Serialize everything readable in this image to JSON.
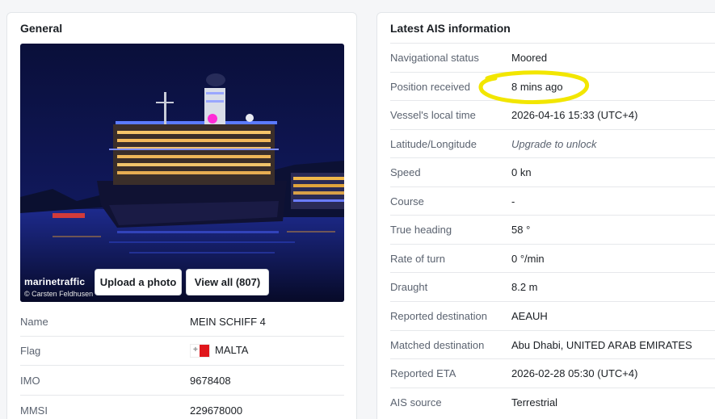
{
  "general": {
    "title": "General",
    "photo": {
      "brand": "marinetraffic",
      "credit": "© Carsten Feldhusen",
      "upload_label": "Upload a photo",
      "view_all_label": "View all (807)"
    },
    "rows": [
      {
        "label": "Name",
        "value": "MEIN SCHIFF 4"
      },
      {
        "label": "Flag",
        "value": "MALTA"
      },
      {
        "label": "IMO",
        "value": "9678408"
      },
      {
        "label": "MMSI",
        "value": "229678000"
      }
    ]
  },
  "ais": {
    "title": "Latest AIS information",
    "rows": [
      {
        "label": "Navigational status",
        "value": "Moored"
      },
      {
        "label": "Position received",
        "value": "8 mins ago"
      },
      {
        "label": "Vessel's local time",
        "value": "2026-04-16 15:33 (UTC+4)"
      },
      {
        "label": "Latitude/Longitude",
        "value": "Upgrade to unlock"
      },
      {
        "label": "Speed",
        "value": "0 kn"
      },
      {
        "label": "Course",
        "value": "-"
      },
      {
        "label": "True heading",
        "value": "58 °"
      },
      {
        "label": "Rate of turn",
        "value": "0 °/min"
      },
      {
        "label": "Draught",
        "value": "8.2 m"
      },
      {
        "label": "Reported destination",
        "value": "AEAUH"
      },
      {
        "label": "Matched destination",
        "value": "Abu Dhabi, UNITED ARAB EMIRATES"
      },
      {
        "label": "Reported ETA",
        "value": "2026-02-28 05:30 (UTC+4)"
      },
      {
        "label": "AIS source",
        "value": "Terrestrial"
      }
    ]
  },
  "colors": {
    "highlight": "#f2e600",
    "flag_red": "#e0161b"
  }
}
